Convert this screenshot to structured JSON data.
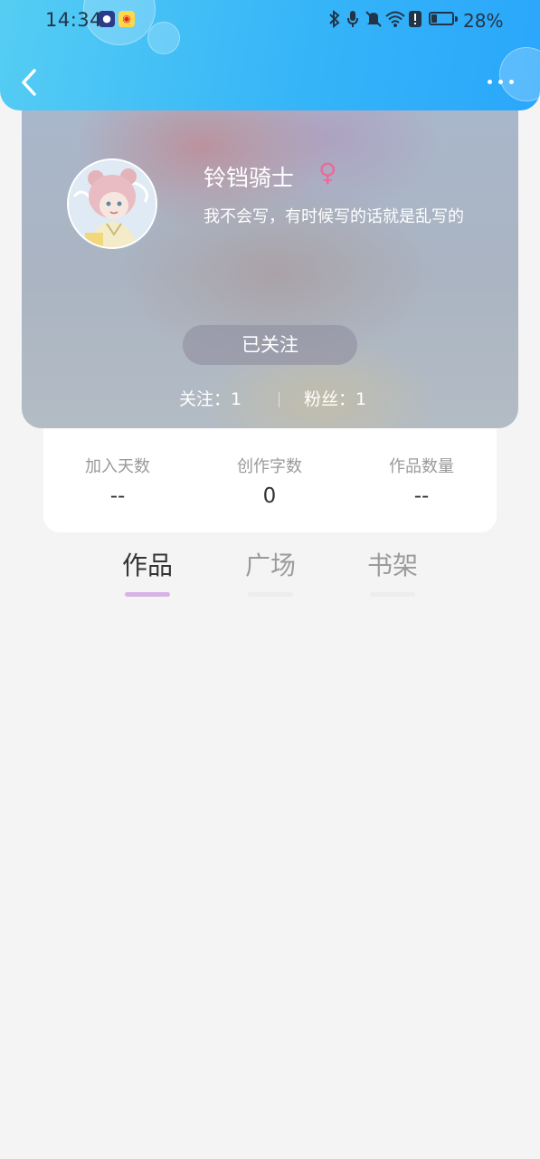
{
  "status_bar": {
    "time": "14:34",
    "battery_percent_text": "28%",
    "battery_level": 0.28,
    "icons": [
      "bluetooth-icon",
      "mic-icon",
      "bell-off-icon",
      "wifi-icon",
      "alert-icon",
      "battery-icon"
    ]
  },
  "profile": {
    "username": "铃铛骑士",
    "gender_symbol": "♀",
    "bio": "我不会写，有时候写的话就是乱写的",
    "follow_button": "已关注",
    "following_label": "关注：1",
    "fans_label": "粉丝：1"
  },
  "stats": [
    {
      "label": "加入天数",
      "value": "--"
    },
    {
      "label": "创作字数",
      "value": "0"
    },
    {
      "label": "作品数量",
      "value": "--"
    }
  ],
  "tabs": [
    {
      "label": "作品",
      "active": true
    },
    {
      "label": "广场",
      "active": false
    },
    {
      "label": "书架",
      "active": false
    }
  ],
  "colors": {
    "header_start": "#55cdf3",
    "header_end": "#2aa7fb",
    "active_tab_indicator": "#d6b3e6",
    "gender_color": "#e96c96"
  }
}
